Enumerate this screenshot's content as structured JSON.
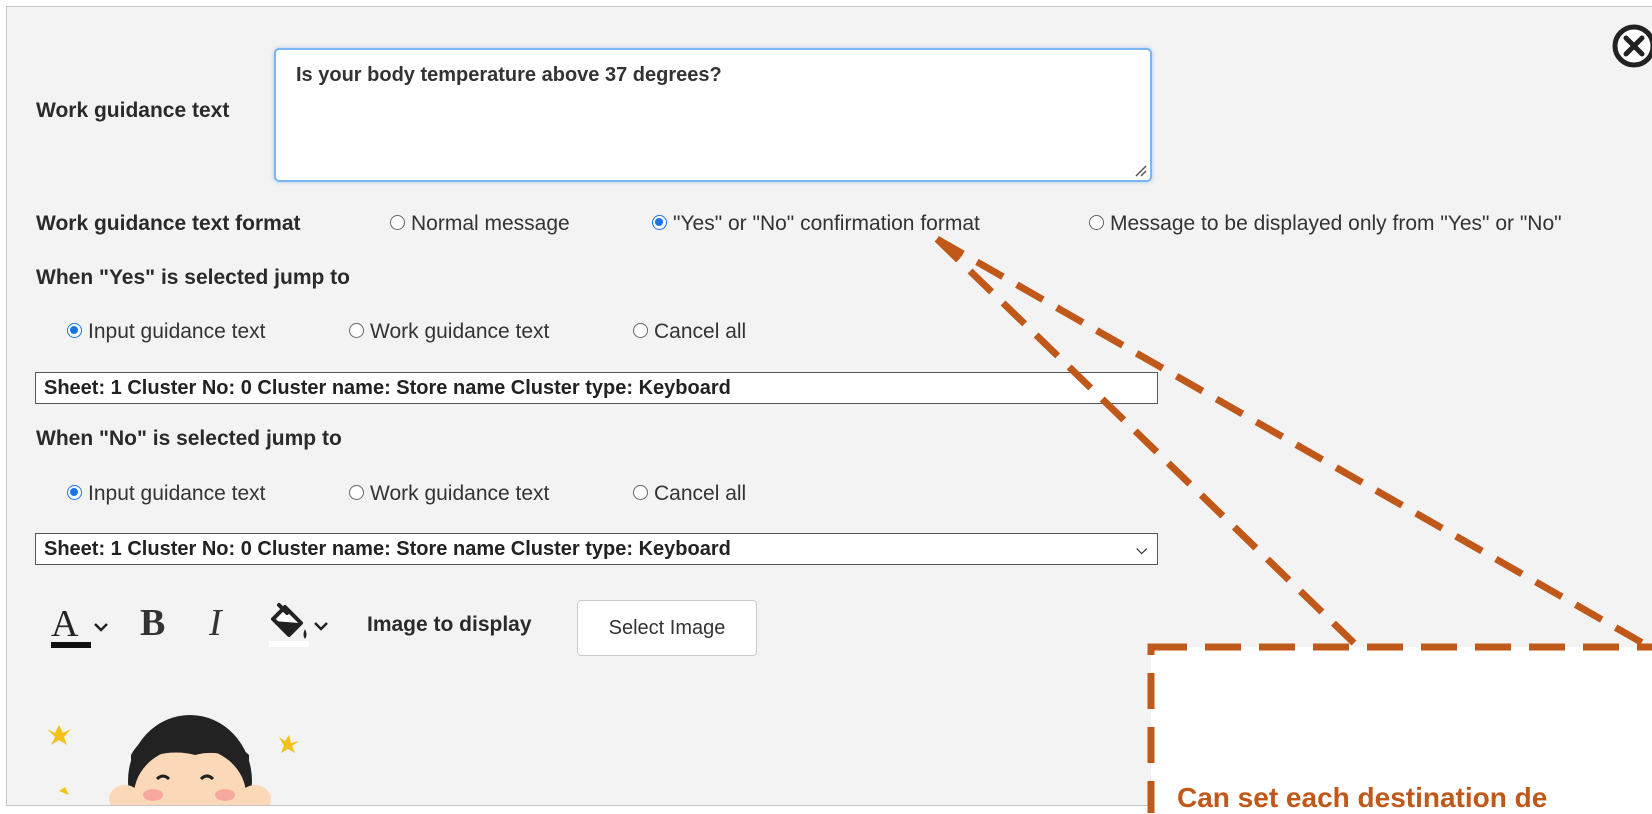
{
  "guidance": {
    "label": "Work guidance text",
    "text": "Is your body temperature above 37 degrees?"
  },
  "format": {
    "label": "Work guidance text format",
    "options": [
      {
        "label": "Normal message",
        "selected": false
      },
      {
        "label": "\"Yes\" or \"No\" confirmation format",
        "selected": true
      },
      {
        "label": "Message to be displayed only from \"Yes\" or \"No\"",
        "selected": false
      }
    ]
  },
  "yes_jump": {
    "label": "When \"Yes\" is selected jump to",
    "options": [
      {
        "label": "Input guidance text",
        "selected": true
      },
      {
        "label": "Work guidance text",
        "selected": false
      },
      {
        "label": "Cancel all",
        "selected": false
      }
    ],
    "select_value": "Sheet: 1 Cluster No: 0 Cluster name: Store name Cluster type: Keyboard"
  },
  "no_jump": {
    "label": "When \"No\" is selected jump to",
    "options": [
      {
        "label": "Input guidance text",
        "selected": true
      },
      {
        "label": "Work guidance text",
        "selected": false
      },
      {
        "label": "Cancel all",
        "selected": false
      }
    ],
    "select_value": "Sheet: 1 Cluster No: 0 Cluster name: Store name Cluster type: Keyboard"
  },
  "toolbar": {
    "text_color_icon": "A",
    "bold_icon": "B",
    "italic_icon": "I",
    "image_label": "Image to display",
    "select_image_button": "Select Image"
  },
  "callout": {
    "text": "Can set each destination de"
  },
  "colors": {
    "accent": "#1a73e8",
    "callout": "#c0581a",
    "panel_bg": "#f3f3f3"
  },
  "icons": [
    "close-icon",
    "text-color-icon",
    "bold-icon",
    "italic-icon",
    "fill-color-icon",
    "chevron-down-icon"
  ]
}
